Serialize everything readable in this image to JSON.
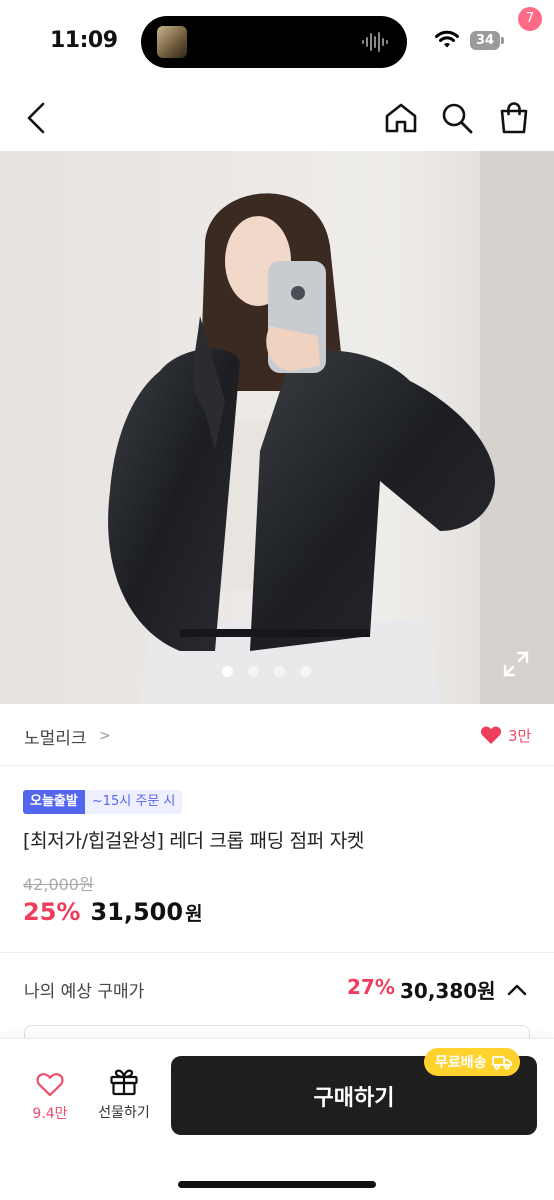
{
  "status": {
    "time": "11:09",
    "battery": "34"
  },
  "nav": {
    "back_icon": "chevron-left-icon",
    "home_icon": "home-icon",
    "search_icon": "search-icon",
    "cart_icon": "shopping-bag-icon",
    "cart_badge": "7"
  },
  "gallery": {
    "image_count": 4,
    "active_index": 0,
    "expand_icon": "expand-icon"
  },
  "brand": {
    "name": "노멀리크",
    "arrow": ">",
    "like_count": "3만"
  },
  "product": {
    "tag_today": "오늘출발",
    "tag_time": "~15시 주문 시",
    "title": "[최저가/힙걸완성] 레더 크롭 패딩 점퍼 자켓",
    "original_price": "42,000원",
    "discount": "25%",
    "sale_price": "31,500",
    "won": "원"
  },
  "expected": {
    "label": "나의 예상 구매가",
    "discount": "27%",
    "price": "30,380원"
  },
  "bottom": {
    "wish_count": "9.4만",
    "gift_label": "선물하기",
    "buy_label": "구매하기",
    "free_shipping": "무료배송"
  },
  "colors": {
    "accent_pink": "#ef3e5c",
    "badge_blue": "#5566ee",
    "free_ship_yellow": "#ffd22e",
    "buy_button": "#1e1e1e"
  }
}
